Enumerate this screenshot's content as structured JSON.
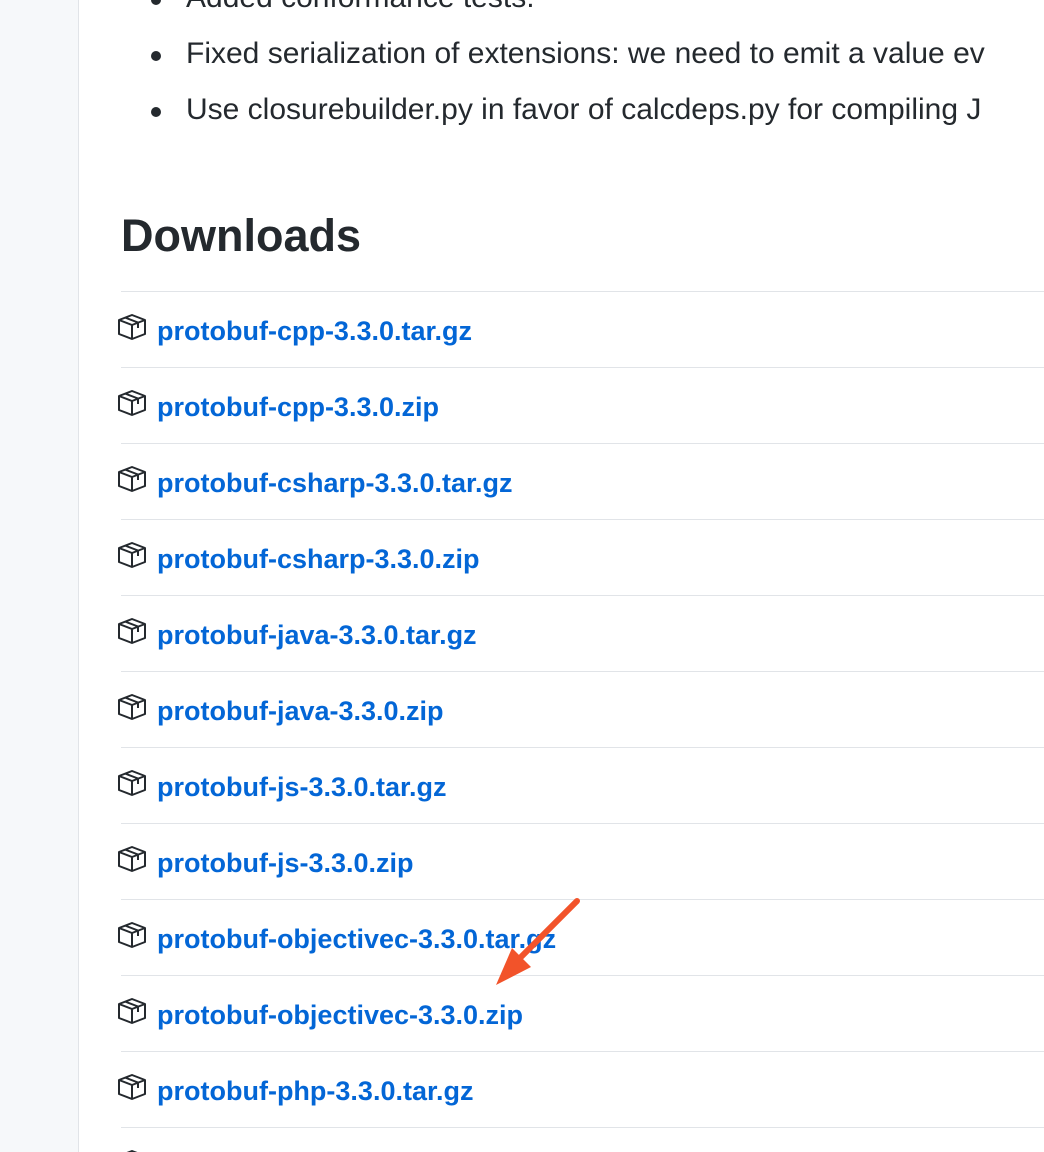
{
  "release_notes": {
    "items": [
      "Added conformance tests.",
      "Fixed serialization of extensions: we need to emit a value ev",
      "Use closurebuilder.py in favor of calcdeps.py for compiling J"
    ]
  },
  "downloads": {
    "heading": "Downloads",
    "files": [
      "protobuf-cpp-3.3.0.tar.gz",
      "protobuf-cpp-3.3.0.zip",
      "protobuf-csharp-3.3.0.tar.gz",
      "protobuf-csharp-3.3.0.zip",
      "protobuf-java-3.3.0.tar.gz",
      "protobuf-java-3.3.0.zip",
      "protobuf-js-3.3.0.tar.gz",
      "protobuf-js-3.3.0.zip",
      "protobuf-objectivec-3.3.0.tar.gz",
      "protobuf-objectivec-3.3.0.zip",
      "protobuf-php-3.3.0.tar.gz"
    ],
    "file_icon": "package-icon"
  },
  "annotation": {
    "icon": "arrow-annotation-icon",
    "color": "#f2532a"
  },
  "colors": {
    "link": "#0366d6",
    "text": "#24292e",
    "divider": "#e1e4e8"
  }
}
